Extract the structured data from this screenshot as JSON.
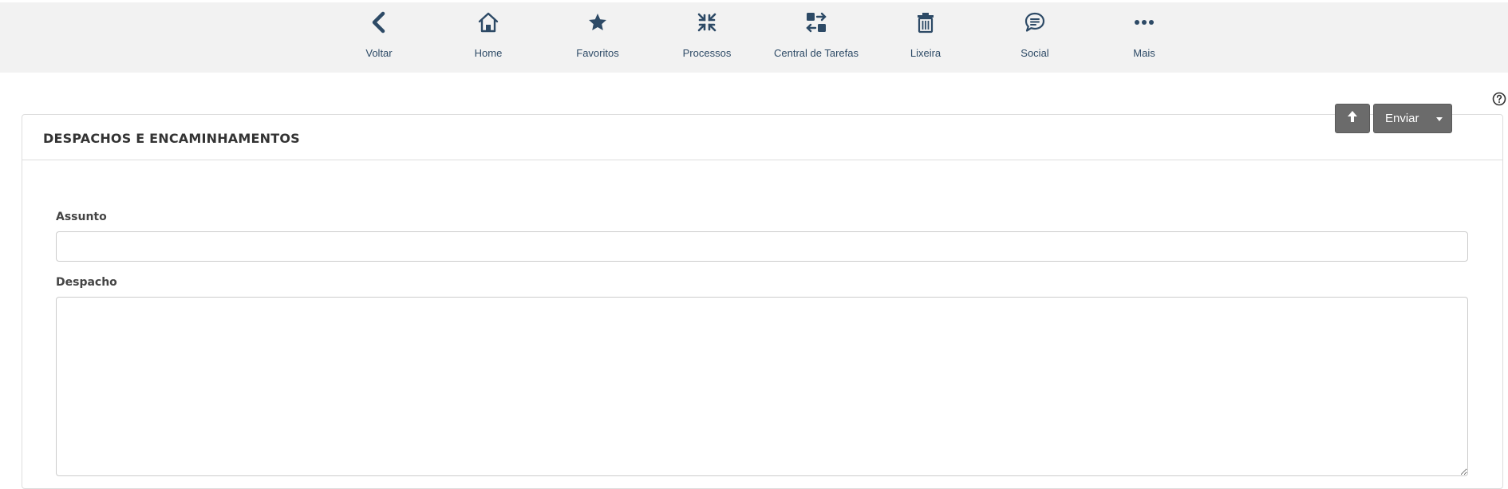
{
  "nav": {
    "items": [
      {
        "label": "Voltar",
        "icon": "chevron-left-icon"
      },
      {
        "label": "Home",
        "icon": "home-icon"
      },
      {
        "label": "Favoritos",
        "icon": "star-icon"
      },
      {
        "label": "Processos",
        "icon": "process-arrows-icon"
      },
      {
        "label": "Central de Tarefas",
        "icon": "task-center-icon"
      },
      {
        "label": "Lixeira",
        "icon": "trash-icon"
      },
      {
        "label": "Social",
        "icon": "chat-bubble-icon"
      },
      {
        "label": "Mais",
        "icon": "more-dots-icon"
      }
    ]
  },
  "toolbar": {
    "send_label": "Enviar",
    "upload_icon": "arrow-up-icon",
    "help_icon": "help-circle-icon"
  },
  "panel": {
    "title": "DESPACHOS E ENCAMINHAMENTOS"
  },
  "form": {
    "subject_label": "Assunto",
    "subject_value": "",
    "dispatch_label": "Despacho",
    "dispatch_value": ""
  },
  "colors": {
    "nav_icon": "#2d4a66",
    "nav_background": "#f2f2f2",
    "button_background": "#6b6b6b"
  }
}
